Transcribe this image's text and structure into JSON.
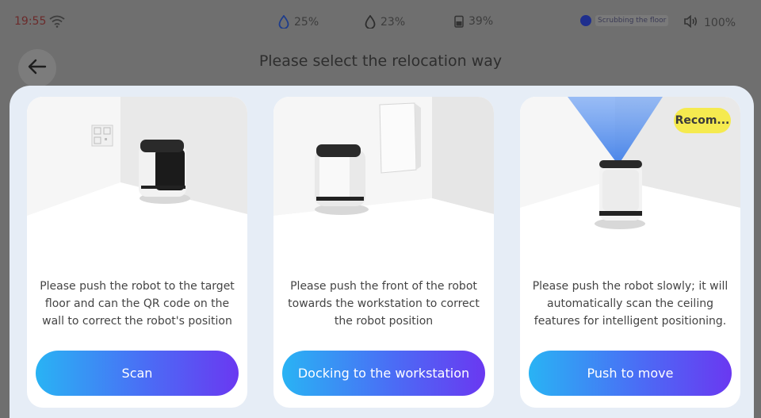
{
  "status_bar": {
    "time": "19:55",
    "water_clean": "25%",
    "water_dirty": "23%",
    "battery": "39%",
    "task_status": "Scrubbing the floor",
    "volume": "100%"
  },
  "header": {
    "title": "Please select the relocation way"
  },
  "cards": [
    {
      "illustration": "robot-scanning-qr-code",
      "description": "Please push the robot to the target floor and can the QR code on the wall to correct the robot's position",
      "button_label": "Scan"
    },
    {
      "illustration": "robot-docking-workstation",
      "description": "Please push the front of the robot towards the workstation to correct the robot position",
      "button_label": "Docking to the workstation"
    },
    {
      "illustration": "robot-ceiling-scan",
      "badge": "Recom...",
      "description": "Please push the robot slowly; it will automatically scan the ceiling features for intelligent positioning.",
      "button_label": "Push to move"
    }
  ],
  "colors": {
    "button_gradient_start": "#29b3f4",
    "button_gradient_end": "#6a38f1",
    "badge": "#f5ea4f",
    "dialog_bg": "#e6edf6"
  }
}
